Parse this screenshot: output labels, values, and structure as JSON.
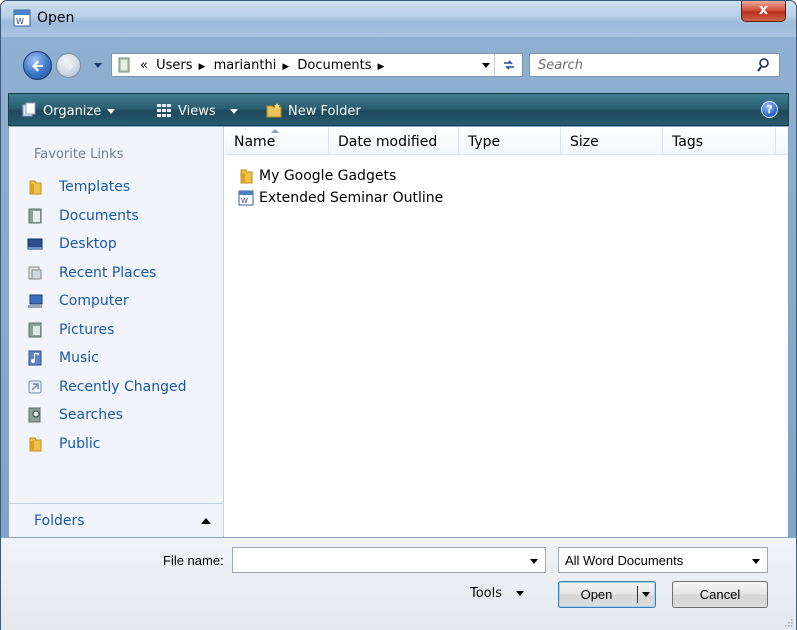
{
  "window": {
    "title": "Open",
    "close_label": "x"
  },
  "address": {
    "prefix": "«",
    "crumbs": [
      "Users",
      "marianthi",
      "Documents"
    ]
  },
  "search": {
    "placeholder": "Search"
  },
  "toolbar": {
    "organize": "Organize",
    "views": "Views",
    "new_folder": "New Folder",
    "help": "?"
  },
  "sidebar": {
    "heading": "Favorite Links",
    "items": [
      {
        "label": "Templates",
        "icon": "folder-icon"
      },
      {
        "label": "Documents",
        "icon": "documents-icon"
      },
      {
        "label": "Desktop",
        "icon": "desktop-icon"
      },
      {
        "label": "Recent Places",
        "icon": "recent-places-icon"
      },
      {
        "label": "Computer",
        "icon": "computer-icon"
      },
      {
        "label": "Pictures",
        "icon": "pictures-icon"
      },
      {
        "label": "Music",
        "icon": "music-icon"
      },
      {
        "label": "Recently Changed",
        "icon": "recently-changed-icon"
      },
      {
        "label": "Searches",
        "icon": "searches-icon"
      },
      {
        "label": "Public",
        "icon": "folder-icon"
      }
    ],
    "folders_label": "Folders"
  },
  "columns": [
    "Name",
    "Date modified",
    "Type",
    "Size",
    "Tags"
  ],
  "files": [
    {
      "name": "My Google Gadgets",
      "icon": "folder-icon"
    },
    {
      "name": "Extended Seminar Outline",
      "icon": "word-document-icon"
    }
  ],
  "bottom": {
    "file_name_label": "File name:",
    "file_name_value": "",
    "file_type": "All Word Documents",
    "tools": "Tools",
    "open": "Open",
    "cancel": "Cancel"
  },
  "colors": {
    "toolbar": "#2b5f72",
    "link": "#1b58a8",
    "close": "#d4533c"
  }
}
